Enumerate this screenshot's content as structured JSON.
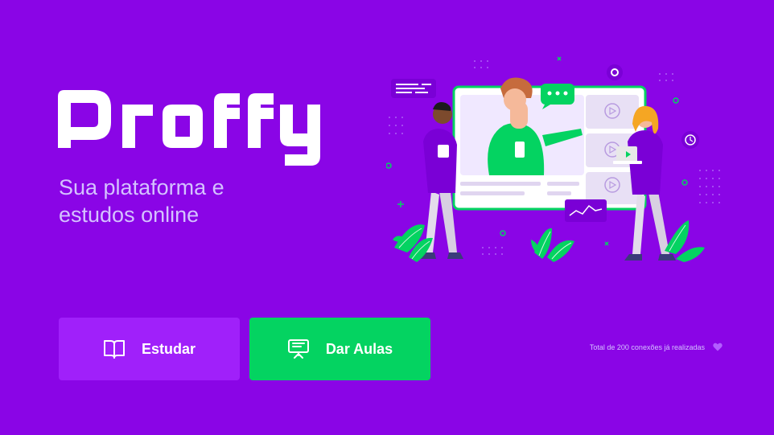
{
  "brand": {
    "name": "Proffy",
    "color": "#FFFFFF"
  },
  "tagline": "Sua plataforma e estudos online",
  "buttons": {
    "study": {
      "label": "Estudar",
      "icon": "book-icon",
      "color": "#A020FA"
    },
    "teach": {
      "label": "Dar Aulas",
      "icon": "presentation-board-icon",
      "color": "#04D361"
    }
  },
  "connections": {
    "text": "Total de 200 conexões já realizadas",
    "icon": "purple-heart-icon"
  },
  "colors": {
    "background": "#8A05E6",
    "accent_green": "#04D361",
    "text_light": "#D4C2FF"
  }
}
